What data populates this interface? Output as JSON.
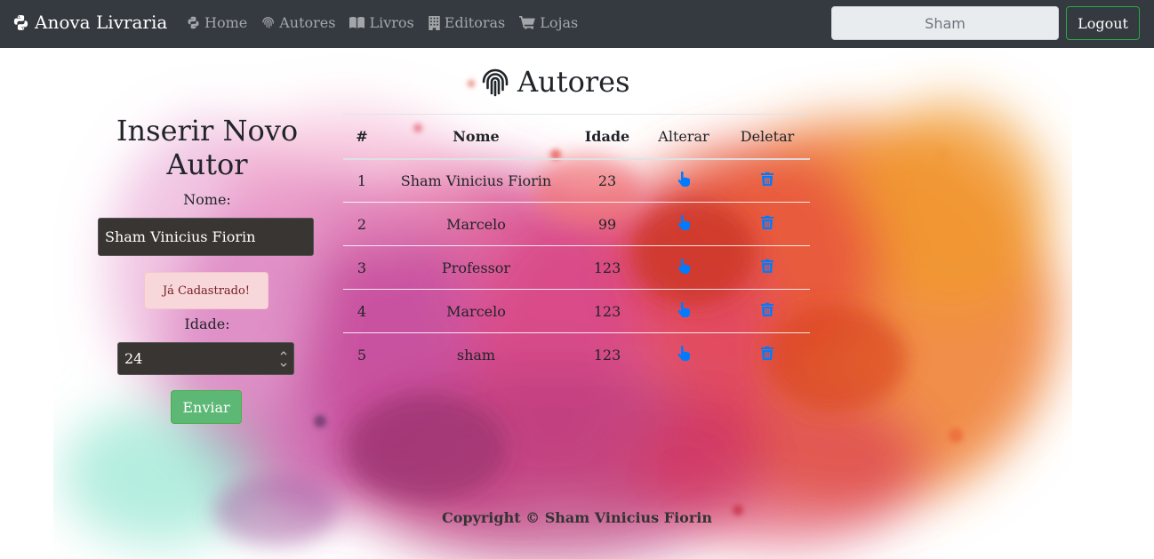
{
  "navbar": {
    "brand": "Anova Livraria",
    "links": [
      {
        "label": "Home",
        "icon": "python-icon"
      },
      {
        "label": "Autores",
        "icon": "fingerprint-icon"
      },
      {
        "label": "Livros",
        "icon": "book-icon"
      },
      {
        "label": "Editoras",
        "icon": "building-icon"
      },
      {
        "label": "Lojas",
        "icon": "cart-icon"
      }
    ],
    "user_value": "Sham",
    "logout_label": "Logout"
  },
  "form": {
    "title": "Inserir Novo Autor",
    "name_label": "Nome:",
    "name_value": "Sham Vinicius Fiorin",
    "alert_text": "Já Cadastrado!",
    "age_label": "Idade:",
    "age_value": "24",
    "submit_label": "Enviar"
  },
  "authors": {
    "heading": "Autores",
    "columns": [
      "#",
      "Nome",
      "Idade",
      "Alterar",
      "Deletar"
    ],
    "rows": [
      {
        "id": "1",
        "name": "Sham Vinicius Fiorin",
        "age": "23"
      },
      {
        "id": "2",
        "name": "Marcelo",
        "age": "99"
      },
      {
        "id": "3",
        "name": "Professor",
        "age": "123"
      },
      {
        "id": "4",
        "name": "Marcelo",
        "age": "123"
      },
      {
        "id": "5",
        "name": "sham",
        "age": "123"
      }
    ],
    "edit_icon": "hand-pointer-icon",
    "delete_icon": "trash-icon"
  },
  "footer": {
    "copyright": "Copyright © Sham Vinicius Fiorin"
  },
  "colors": {
    "navbar": "#343a40",
    "accent_link": "#007bff",
    "submit": "#5cb874",
    "alert_bg": "#f8d7da"
  }
}
